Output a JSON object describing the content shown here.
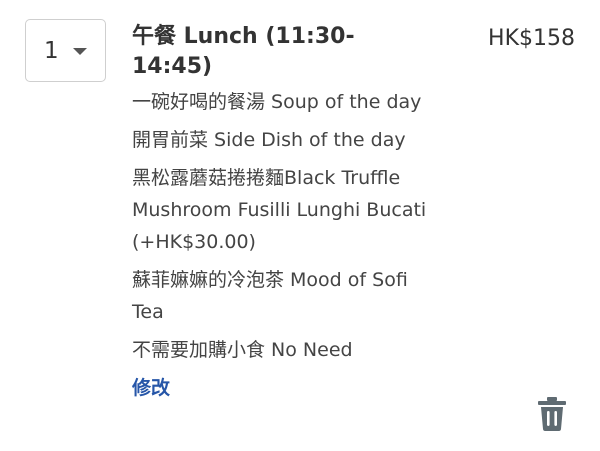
{
  "item": {
    "quantity": "1",
    "title": "午餐 Lunch (11:30-14:45)",
    "price": "HK$158",
    "options": [
      "一碗好喝的餐湯 Soup of the day",
      "開胃前菜 Side Dish of the day",
      "黑松露蘑菇捲捲麵Black Truffle Mushroom Fusilli Lunghi Bucati (+HK$30.00)",
      "蘇菲嫲嫲的冷泡茶 Mood of Sofi Tea",
      "不需要加購小食 No Need"
    ],
    "edit_label": "修改"
  },
  "icons": {
    "quantity_dropdown": "chevron-down-icon",
    "delete": "trash-icon"
  },
  "colors": {
    "link": "#2656a8",
    "text": "#333333",
    "icon": "#5f6b72"
  }
}
